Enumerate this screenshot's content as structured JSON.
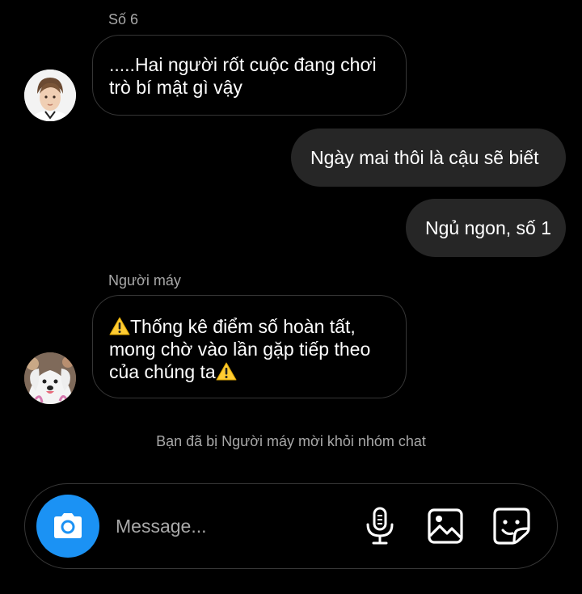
{
  "colors": {
    "background": "#000000",
    "incoming_border": "#363636",
    "outgoing_bubble": "#262626",
    "meta_text": "#a8a8a8",
    "camera_button": "#1b92f4"
  },
  "messages": [
    {
      "sender": "Số 6",
      "direction": "incoming",
      "lines": [
        ".....Hai người rốt cuộc đang chơi",
        "trò bí mật gì vậy"
      ]
    },
    {
      "direction": "outgoing",
      "text": "Ngày mai thôi là cậu sẽ biết"
    },
    {
      "direction": "outgoing",
      "text": "Ngủ ngon, số 1"
    },
    {
      "sender": "Người máy",
      "direction": "incoming",
      "lines": [
        "Thống kê điểm số hoàn tất,",
        "mong chờ vào lần gặp tiếp theo",
        "của chúng ta"
      ],
      "emoji": "warning-icon"
    }
  ],
  "system_note": "Bạn đã bị Người máy mời khỏi nhóm chat",
  "composer": {
    "placeholder": "Message...",
    "icons": [
      "camera-icon",
      "microphone-icon",
      "gallery-icon",
      "sticker-icon"
    ]
  }
}
